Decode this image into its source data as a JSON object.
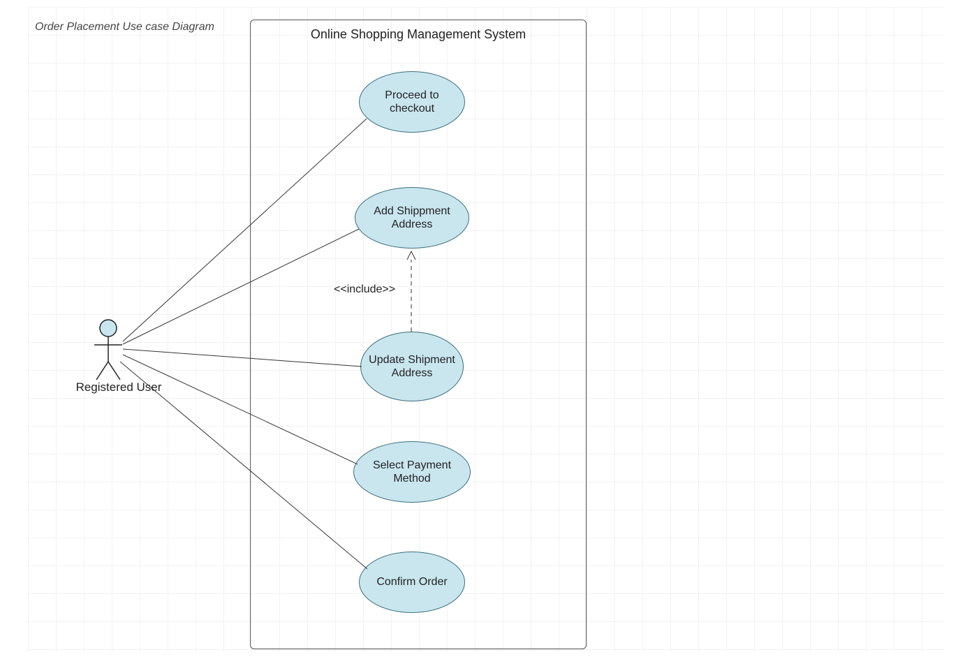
{
  "diagram": {
    "title": "Order Placement Use case Diagram",
    "system_name": "Online Shopping Management System",
    "actor": {
      "name": "Registered User"
    },
    "include_label": "<<include>>",
    "usecases": {
      "uc1": "Proceed to checkout",
      "uc2": "Add Shippment Address",
      "uc3": "Update Shipment Address",
      "uc4": "Select Payment Method",
      "uc5": "Confirm Order"
    }
  }
}
